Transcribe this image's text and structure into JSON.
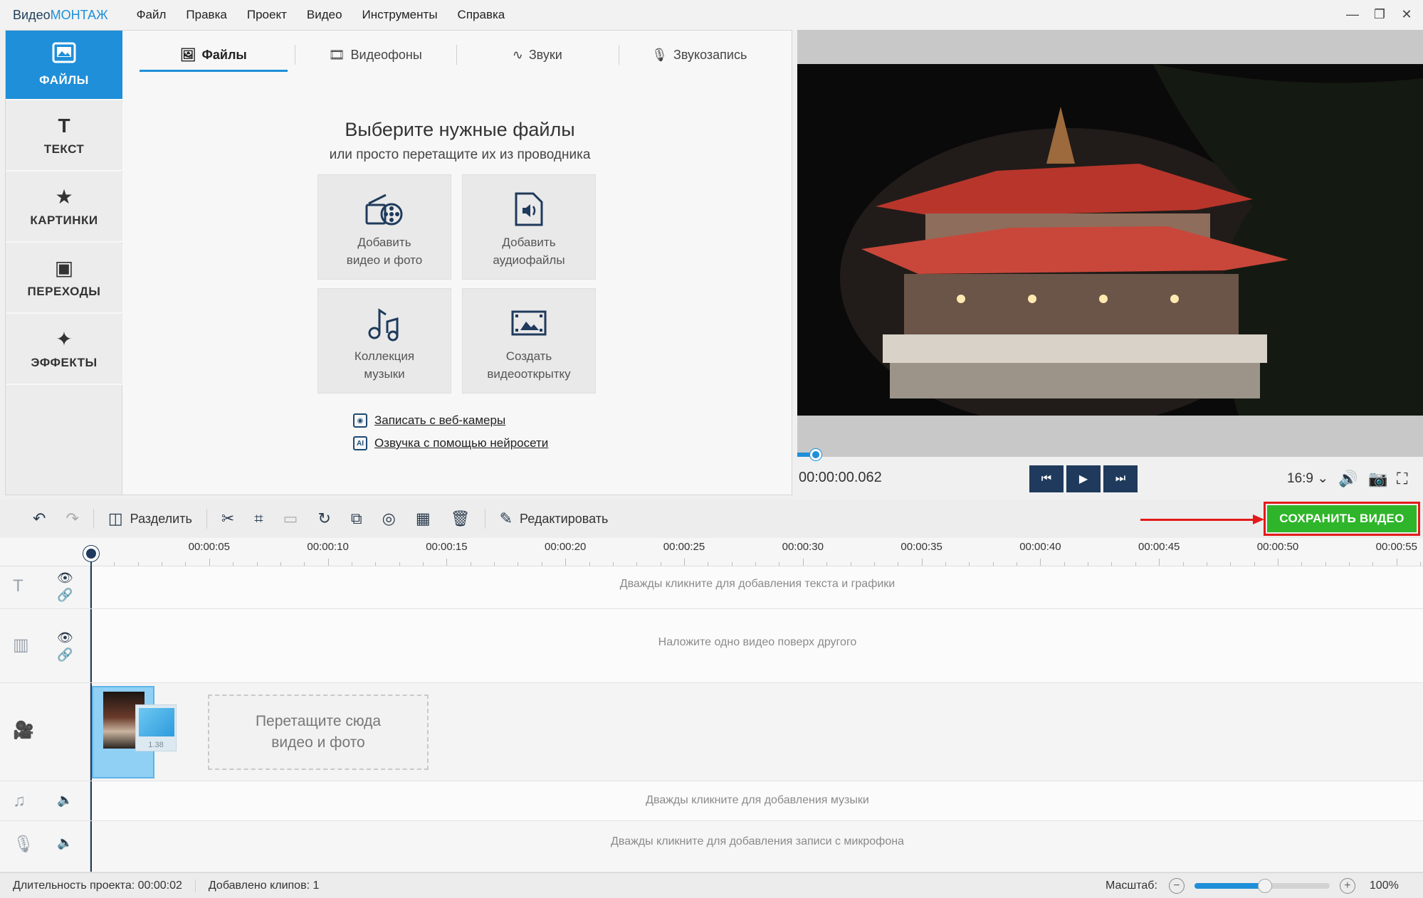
{
  "app": {
    "logo_main": "Видео",
    "logo_accent": "МОНТАЖ",
    "menu": [
      "Файл",
      "Правка",
      "Проект",
      "Видео",
      "Инструменты",
      "Справка"
    ]
  },
  "sidebar": {
    "items": [
      {
        "label": "ФАЙЛЫ",
        "icon": "image-icon",
        "glyph": "🖼",
        "active": true
      },
      {
        "label": "ТЕКСТ",
        "icon": "text-icon",
        "glyph": "T",
        "active": false
      },
      {
        "label": "КАРТИНКИ",
        "icon": "star-icon",
        "glyph": "★",
        "active": false
      },
      {
        "label": "ПЕРЕХОДЫ",
        "icon": "transitions-icon",
        "glyph": "▣",
        "active": false
      },
      {
        "label": "ЭФФЕКТЫ",
        "icon": "magic-wand-icon",
        "glyph": "✦",
        "active": false
      }
    ]
  },
  "tabs": [
    {
      "label": "Файлы",
      "glyph": "🖼",
      "active": true
    },
    {
      "label": "Видеофоны",
      "glyph": "🎞",
      "active": false
    },
    {
      "label": "Звуки",
      "glyph": "∿",
      "active": false
    },
    {
      "label": "Звукозапись",
      "glyph": "🎙",
      "active": false
    }
  ],
  "files_panel": {
    "title": "Выберите нужные файлы",
    "subtitle": "или просто перетащите их из проводника",
    "tiles": [
      {
        "label": "Добавить\nвидео и фото",
        "icon": "film-reel-icon"
      },
      {
        "label": "Добавить\nаудиофайлы",
        "icon": "audio-file-icon"
      },
      {
        "label": "Коллекция\nмузыки",
        "icon": "music-notes-icon"
      },
      {
        "label": "Создать\nвидеооткрытку",
        "icon": "postcard-icon"
      }
    ],
    "links": [
      {
        "label": "Записать с веб-камеры",
        "glyph": "◉"
      },
      {
        "label": "Озвучка с помощью нейросети",
        "glyph": "AI"
      }
    ]
  },
  "preview": {
    "timecode": "00:00:00.062",
    "ratio": "16:9 ⌄",
    "progress": 0.03
  },
  "toolbar": {
    "split_label": "Разделить",
    "edit_label": "Редактировать",
    "save_label": "СОХРАНИТЬ ВИДЕО"
  },
  "timeline": {
    "ticks": [
      "00:00:05",
      "00:00:10",
      "00:00:15",
      "00:00:20",
      "00:00:25",
      "00:00:30",
      "00:00:35",
      "00:00:40",
      "00:00:45",
      "00:00:50",
      "00:00:55"
    ],
    "text_hint": "Дважды кликните для добавления текста и графики",
    "overlay_hint": "Наложите одно видео поверх другого",
    "drop_hint": "Перетащите сюда\nвидео и фото",
    "music_hint": "Дважды кликните для добавления музыки",
    "mic_hint": "Дважды кликните для добавления записи с микрофона",
    "transition_label": "1.38"
  },
  "status": {
    "duration": "Длительность проекта:  00:00:02",
    "clips": "Добавлено клипов: 1",
    "zoom_label": "Масштаб:",
    "zoom_value": "100%",
    "zoom_level": 0.52
  }
}
